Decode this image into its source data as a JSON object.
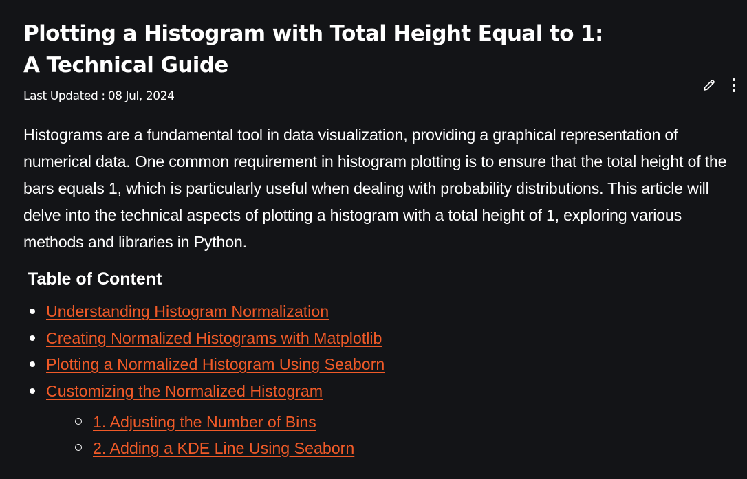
{
  "article": {
    "title": "Plotting a Histogram with Total Height Equal to 1: A Technical Guide",
    "last_updated_label": "Last Updated :",
    "last_updated_date": "08 Jul, 2024",
    "intro": "Histograms are a fundamental tool in data visualization, providing a graphical representation of numerical data. One common requirement in histogram plotting is to ensure that the total height of the bars equals 1, which is particularly useful when dealing with probability distributions. This article will delve into the technical aspects of plotting a histogram with a total height of 1, exploring various methods and libraries in Python."
  },
  "actions": {
    "edit_icon": "pencil-icon",
    "more_icon": "kebab-menu-icon"
  },
  "toc": {
    "title": "Table of Content",
    "items": [
      {
        "label": "Understanding Histogram Normalization"
      },
      {
        "label": "Creating Normalized Histograms with Matplotlib"
      },
      {
        "label": "Plotting a Normalized Histogram Using Seaborn"
      },
      {
        "label": "Customizing the Normalized Histogram"
      }
    ],
    "subitems": [
      {
        "label": "1. Adjusting the Number of Bins"
      },
      {
        "label": "2. Adding a KDE Line Using Seaborn"
      }
    ]
  },
  "colors": {
    "background": "#131417",
    "text": "#ffffff",
    "link": "#f05a28",
    "divider": "#2c2e33"
  }
}
